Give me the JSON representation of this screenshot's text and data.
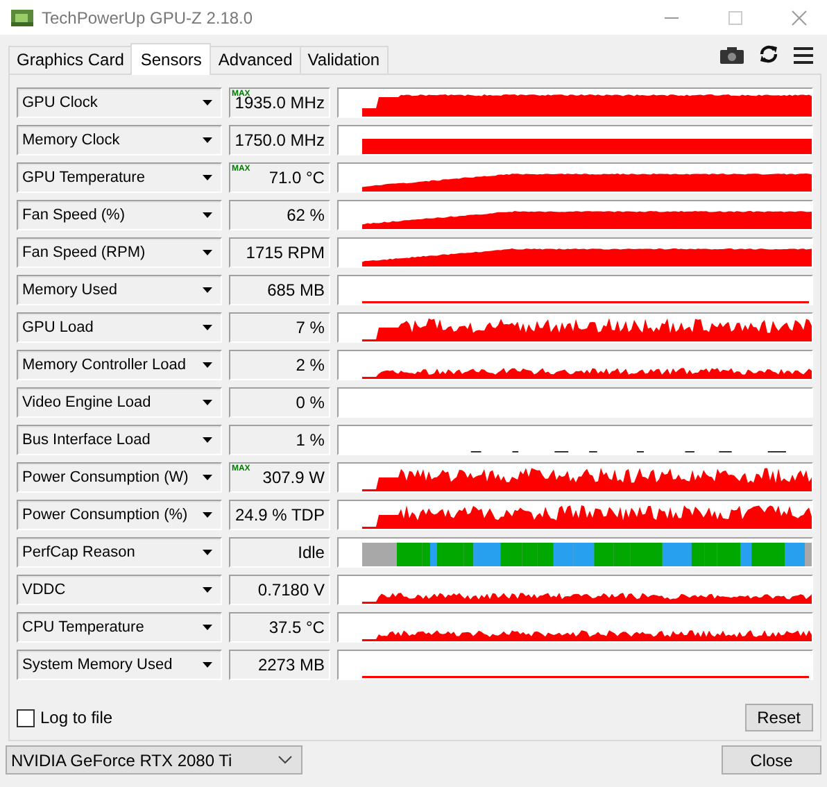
{
  "window": {
    "title": "TechPowerUp GPU-Z 2.18.0"
  },
  "tabs": [
    {
      "label": "Graphics Card",
      "selected": false
    },
    {
      "label": "Sensors",
      "selected": true
    },
    {
      "label": "Advanced",
      "selected": false
    },
    {
      "label": "Validation",
      "selected": false
    }
  ],
  "sensors": [
    {
      "label": "GPU Clock",
      "badge": "MAX",
      "value": "1935.0 MHz",
      "kind": "full"
    },
    {
      "label": "Memory Clock",
      "value": "1750.0 MHz",
      "kind": "flat"
    },
    {
      "label": "GPU Temperature",
      "badge": "MAX",
      "value": "71.0 °C",
      "kind": "ramp"
    },
    {
      "label": "Fan Speed (%)",
      "value": "62 %",
      "kind": "ramp"
    },
    {
      "label": "Fan Speed (RPM)",
      "value": "1715 RPM",
      "kind": "ramp"
    },
    {
      "label": "Memory Used",
      "value": "685 MB",
      "kind": "thin"
    },
    {
      "label": "GPU Load",
      "value": "7 %",
      "kind": "spiky"
    },
    {
      "label": "Memory Controller Load",
      "value": "2 %",
      "kind": "low"
    },
    {
      "label": "Video Engine Load",
      "value": "0 %",
      "kind": "none"
    },
    {
      "label": "Bus Interface Load",
      "value": "1 %",
      "kind": "dashes"
    },
    {
      "label": "Power Consumption (W)",
      "badge": "MAX",
      "value": "307.9 W",
      "kind": "spiky"
    },
    {
      "label": "Power Consumption (%)",
      "value": "24.9 % TDP",
      "kind": "spiky"
    },
    {
      "label": "PerfCap Reason",
      "value": "Idle",
      "kind": "perfcap"
    },
    {
      "label": "VDDC",
      "value": "0.7180 V",
      "kind": "low"
    },
    {
      "label": "CPU Temperature",
      "value": "37.5 °C",
      "kind": "low"
    },
    {
      "label": "System Memory Used",
      "value": "2273 MB",
      "kind": "thin"
    }
  ],
  "log_to_file": {
    "label": "Log to file",
    "checked": false
  },
  "reset_button": "Reset",
  "device": "NVIDIA GeForce RTX 2080 Ti",
  "close_button": "Close"
}
